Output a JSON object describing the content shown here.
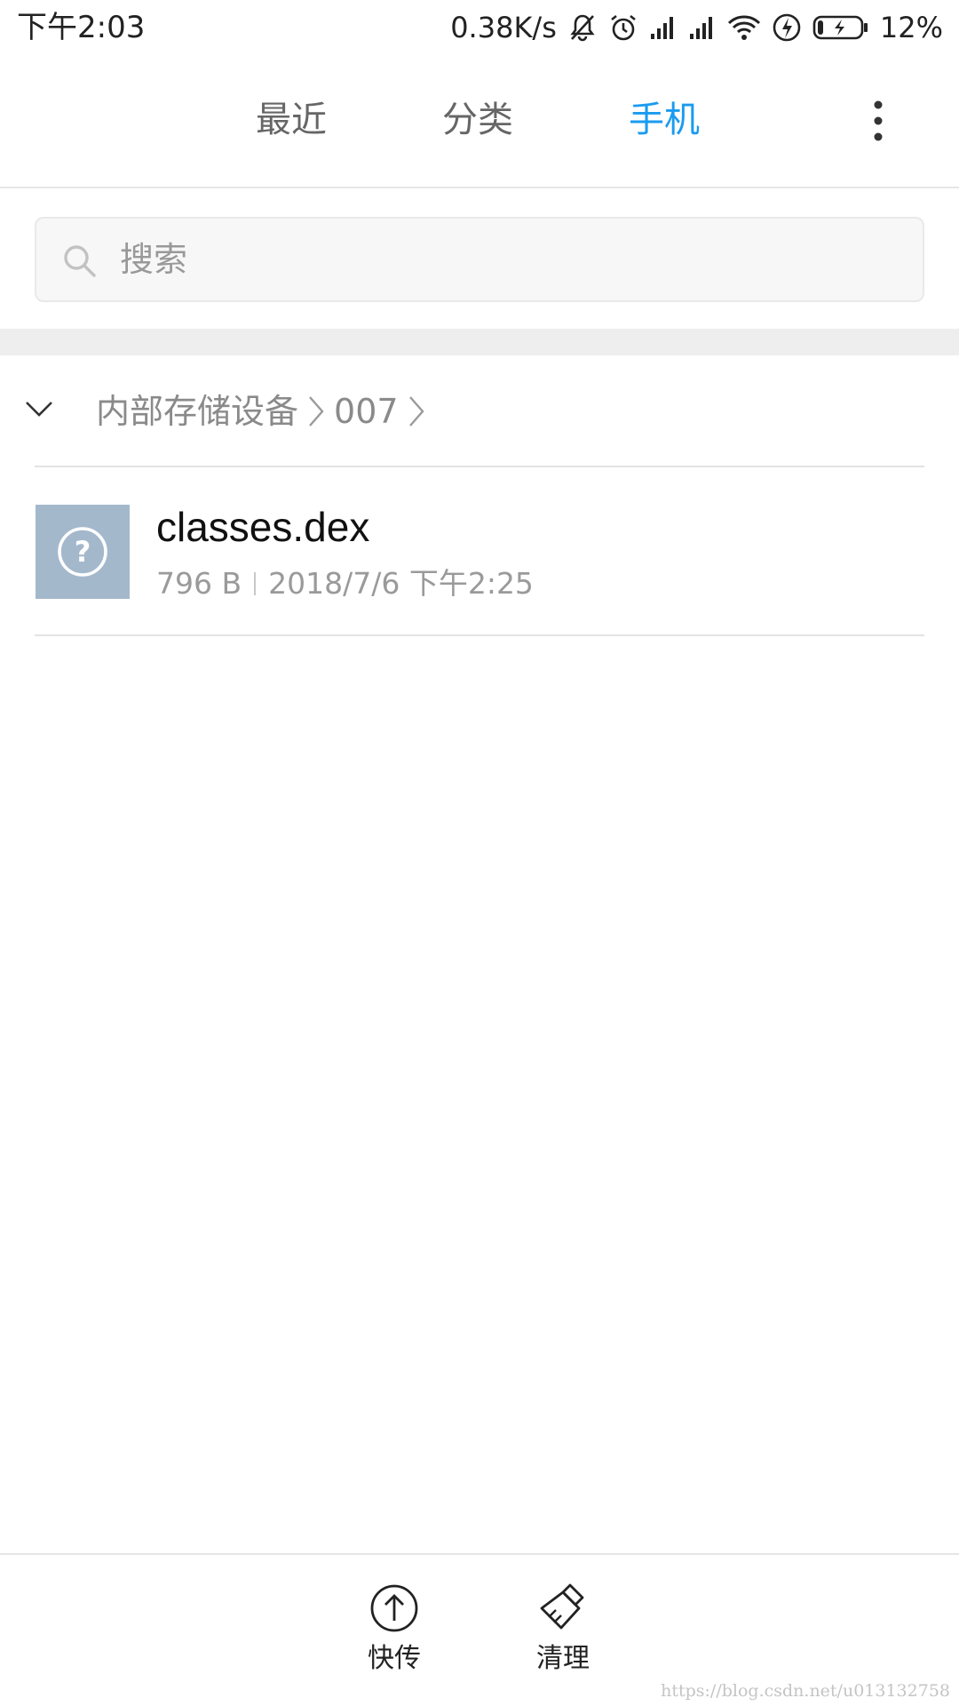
{
  "status_bar": {
    "time": "下午2:03",
    "net_speed": "0.38K/s",
    "battery": "12%",
    "icons": [
      "mute-icon",
      "alarm-icon",
      "signal-icon",
      "signal-icon",
      "wifi-icon",
      "charging-icon",
      "battery-icon"
    ]
  },
  "header": {
    "tabs": [
      {
        "label": "最近",
        "active": false
      },
      {
        "label": "分类",
        "active": false
      },
      {
        "label": "手机",
        "active": true
      }
    ],
    "menu_icon": "more-vertical-icon"
  },
  "colors": {
    "accent": "#1a9bf0",
    "thumb": "#a4b8cc"
  },
  "search": {
    "placeholder": "搜索",
    "value": ""
  },
  "breadcrumb": {
    "items": [
      "内部存储设备",
      "007"
    ]
  },
  "files": [
    {
      "name": "classes.dex",
      "size": "796 B",
      "modified": "2018/7/6 下午2:25",
      "icon": "unknown-file-icon"
    }
  ],
  "bottom_bar": {
    "transfer_label": "快传",
    "clean_label": "清理"
  },
  "watermark": "https://blog.csdn.net/u013132758"
}
